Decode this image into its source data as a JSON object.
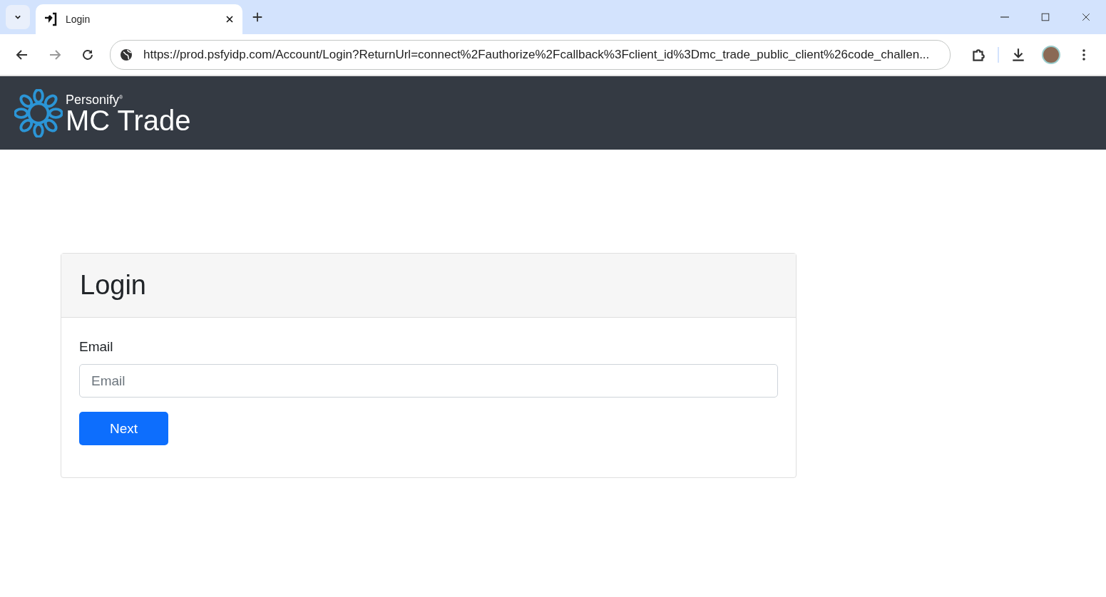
{
  "browser": {
    "tabs": [
      {
        "title": "Login",
        "selected": true
      }
    ],
    "url": "https://prod.psfyidp.com/Account/Login?ReturnUrl=connect%2Fauthorize%2Fcallback%3Fclient_id%3Dmc_trade_public_client%26code_challen..."
  },
  "header": {
    "brand": "Personify$^{®}$",
    "product": "MC Trade"
  },
  "card": {
    "title": "Login",
    "field_label": "Email",
    "email": {
      "placeholder": "Email"
    },
    "button": "Next"
  }
}
